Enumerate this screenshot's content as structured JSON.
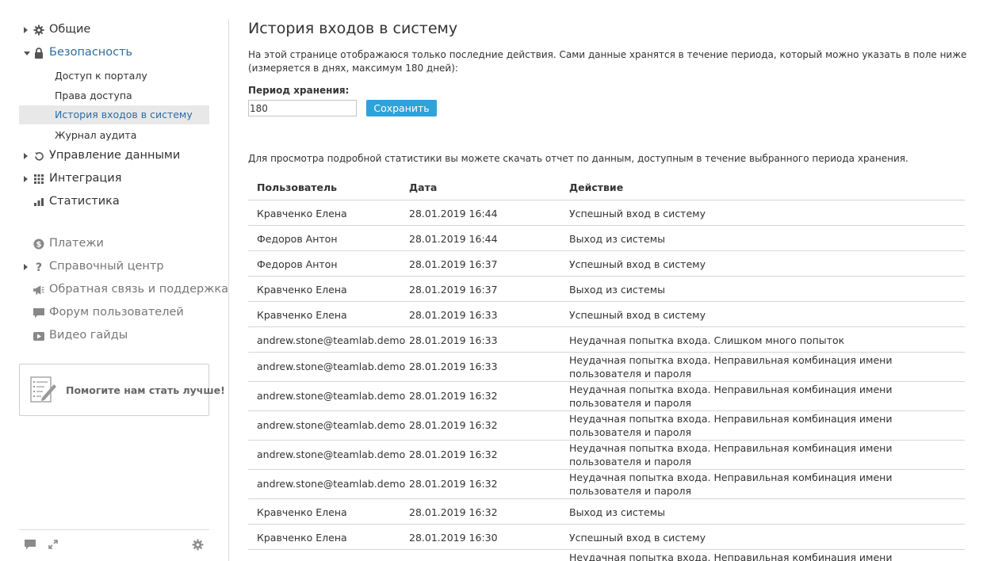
{
  "sidebar": {
    "items": [
      {
        "label": "Общие",
        "icon": "gear-icon",
        "arrow": "right"
      },
      {
        "label": "Безопасность",
        "icon": "lock-icon",
        "arrow": "down",
        "active": true
      },
      {
        "label": "Управление данными",
        "icon": "restore-icon",
        "arrow": "right"
      },
      {
        "label": "Интеграция",
        "icon": "grid-icon",
        "arrow": "right"
      },
      {
        "label": "Статистика",
        "icon": "bar-chart-icon"
      }
    ],
    "security_sub": [
      {
        "label": "Доступ к порталу"
      },
      {
        "label": "Права доступа"
      },
      {
        "label": "История входов в систему",
        "selected": true
      },
      {
        "label": "Журнал аудита"
      }
    ],
    "links": [
      {
        "label": "Платежи",
        "icon": "dollar-icon"
      },
      {
        "label": "Справочный центр",
        "icon": "question-icon",
        "arrow": "right"
      },
      {
        "label": "Обратная связь и поддержка",
        "icon": "megaphone-icon"
      },
      {
        "label": "Форум пользователей",
        "icon": "chat-bubble-icon"
      },
      {
        "label": "Видео гайды",
        "icon": "video-play-icon"
      }
    ],
    "help_box": {
      "label": "Помогите нам стать лучше!"
    }
  },
  "main": {
    "title": "История входов в систему",
    "description": "На этой странице отображаюся только последние действия. Сами данные хранятся в течение периода, который можно указать в поле ниже (измеряется в днях, максимум 180 дней):",
    "period_label": "Период хранения:",
    "period_value": "180",
    "save_label": "Сохранить",
    "stats_note": "Для просмотра подробной статистики вы можете скачать отчет по данным, доступным в течение выбранного периода хранения.",
    "columns": [
      "Пользователь",
      "Дата",
      "Действие"
    ],
    "rows": [
      {
        "user": "Кравченко Елена",
        "date": "28.01.2019 16:44",
        "action": "Успешный вход в систему"
      },
      {
        "user": "Федоров Антон",
        "date": "28.01.2019 16:44",
        "action": "Выход из системы"
      },
      {
        "user": "Федоров Антон",
        "date": "28.01.2019 16:37",
        "action": "Успешный вход в систему"
      },
      {
        "user": "Кравченко Елена",
        "date": "28.01.2019 16:37",
        "action": "Выход из системы"
      },
      {
        "user": "Кравченко Елена",
        "date": "28.01.2019 16:33",
        "action": "Успешный вход в систему"
      },
      {
        "user": "andrew.stone@teamlab.demo",
        "date": "28.01.2019 16:33",
        "action": "Неудачная попытка входа. Слишком много попыток"
      },
      {
        "user": "andrew.stone@teamlab.demo",
        "date": "28.01.2019 16:33",
        "action": "Неудачная попытка входа. Неправильная комбинация имени пользователя и пароля"
      },
      {
        "user": "andrew.stone@teamlab.demo",
        "date": "28.01.2019 16:32",
        "action": "Неудачная попытка входа. Неправильная комбинация имени пользователя и пароля"
      },
      {
        "user": "andrew.stone@teamlab.demo",
        "date": "28.01.2019 16:32",
        "action": "Неудачная попытка входа. Неправильная комбинация имени пользователя и пароля"
      },
      {
        "user": "andrew.stone@teamlab.demo",
        "date": "28.01.2019 16:32",
        "action": "Неудачная попытка входа. Неправильная комбинация имени пользователя и пароля"
      },
      {
        "user": "andrew.stone@teamlab.demo",
        "date": "28.01.2019 16:32",
        "action": "Неудачная попытка входа. Неправильная комбинация имени пользователя и пароля"
      },
      {
        "user": "Кравченко Елена",
        "date": "28.01.2019 16:32",
        "action": "Выход из системы"
      },
      {
        "user": "Кравченко Елена",
        "date": "28.01.2019 16:30",
        "action": "Успешный вход в систему"
      },
      {
        "user": "",
        "date": "",
        "action": "Неудачная попытка входа. Неправильная комбинация имени пользователя и"
      }
    ]
  },
  "footer_icons": [
    "chat-icon",
    "expand-icon",
    "settings-gear-icon"
  ],
  "colors": {
    "accent": "#2ea2d9",
    "link_active": "#2d6da3",
    "selected_bg": "#e8e8e8"
  }
}
